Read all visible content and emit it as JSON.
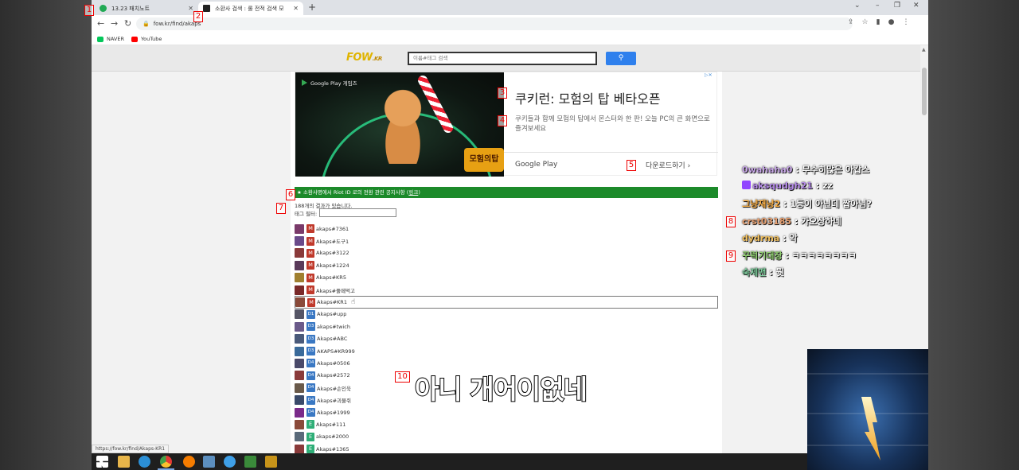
{
  "browser": {
    "tabs": [
      {
        "label": "13.23 패치노트",
        "active": false
      },
      {
        "label": "소환사 검색 : 롤 전적 검색 모",
        "active": true
      }
    ],
    "new_tab": "+",
    "address": "fow.kr/find/akaps",
    "bookmarks": [
      "NAVER",
      "YouTube"
    ]
  },
  "site": {
    "logo": "FOW",
    "logo_suffix": ".KR",
    "search_placeholder": "이름#태그 검색"
  },
  "ad": {
    "source": "Google Play 게임즈",
    "title": "쿠키런: 모험의 탑 베타오픈",
    "description": "쿠키들과 함께 모험의 탑에서 몬스터와 한 판! 오늘 PC의 큰 화면으로 즐겨보세요",
    "store": "Google Play",
    "download": "다운로드하기",
    "game_logo": "모험의탑"
  },
  "notice": {
    "text": "★ 소환사명에서 Riot ID 로의 전환 관련 공지사항 (",
    "link": "링크",
    "end": ")"
  },
  "results": {
    "count_text": "188개의 결과가 있습니다.",
    "tag_filter_label": "태그 필터:",
    "rows": [
      {
        "name": "akaps#7361",
        "tier": "M",
        "color": "#7a3a6a"
      },
      {
        "name": "Akaps#도구1",
        "tier": "M",
        "color": "#6a4a8a"
      },
      {
        "name": "Akaps#3122",
        "tier": "M",
        "color": "#8a3a3a"
      },
      {
        "name": "Akaps#1224",
        "tier": "M",
        "color": "#5a3a5a"
      },
      {
        "name": "Akaps#KR5",
        "tier": "M",
        "color": "#a08030"
      },
      {
        "name": "Akaps#풀떼먹고",
        "tier": "M",
        "color": "#7a2a2a"
      },
      {
        "name": "Akaps#KR1",
        "tier": "M",
        "color": "#8a4a3a",
        "highlight": true
      },
      {
        "name": "Akaps#upp",
        "tier": "D1",
        "color": "#556"
      },
      {
        "name": "akaps#twich",
        "tier": "D3",
        "color": "#6a5a8a"
      },
      {
        "name": "Akaps#ABC",
        "tier": "D3",
        "color": "#4a5a7a"
      },
      {
        "name": "AKAPS#KR999",
        "tier": "D3",
        "color": "#3a6a9a"
      },
      {
        "name": "Akaps#0506",
        "tier": "D4",
        "color": "#4a4a6a"
      },
      {
        "name": "Akaps#2572",
        "tier": "D4",
        "color": "#8a3a3a"
      },
      {
        "name": "Akaps#손인욱",
        "tier": "D4",
        "color": "#6a5a4a"
      },
      {
        "name": "Akaps#괴물쥐",
        "tier": "D4",
        "color": "#3a4a6a"
      },
      {
        "name": "Akaps#1999",
        "tier": "D4",
        "color": "#7a2a8a"
      },
      {
        "name": "Akaps#111",
        "tier": "E",
        "color": "#8a4a3a"
      },
      {
        "name": "akaps#2000",
        "tier": "E",
        "color": "#5a6a7a"
      },
      {
        "name": "Akaps#1365",
        "tier": "E",
        "color": "#8a3a3a"
      }
    ]
  },
  "status_url": "https://fow.kr/find/Akaps-KR1",
  "chat": [
    {
      "user": "0wahaha0",
      "text": "무수히많은 아캅스",
      "color": "#c9a8e8",
      "twitch": false
    },
    {
      "user": "aksqudgh21",
      "text": "zz",
      "color": "#b48ae8",
      "twitch": true
    },
    {
      "user": "그냥재냥2",
      "text": "1등이 아닌데 짭아님?",
      "color": "#ffb347",
      "twitch": false
    },
    {
      "user": "crst03185",
      "text": "가오상하네",
      "color": "#e8a070",
      "twitch": false
    },
    {
      "user": "dydrma",
      "text": "악",
      "color": "#f0c060",
      "twitch": false
    },
    {
      "user": "꾸럭기대장",
      "text": "ㅋㅋㅋㅋㅋㅋㅋㅋ",
      "color": "#90d070",
      "twitch": false
    },
    {
      "user": "숙제맨",
      "text": "뭣",
      "color": "#80d0a0",
      "twitch": false
    }
  ],
  "subtitle": "아니 개어이없네",
  "markers": [
    "1",
    "2",
    "3",
    "4",
    "5",
    "6",
    "7",
    "8",
    "9",
    "10"
  ],
  "colors": {
    "notice_green": "#1c8a2a",
    "search_blue": "#2f80ed",
    "tier_master": "#c0392b",
    "tier_diamond": "#3a78c3",
    "tier_emerald": "#2fae77"
  }
}
